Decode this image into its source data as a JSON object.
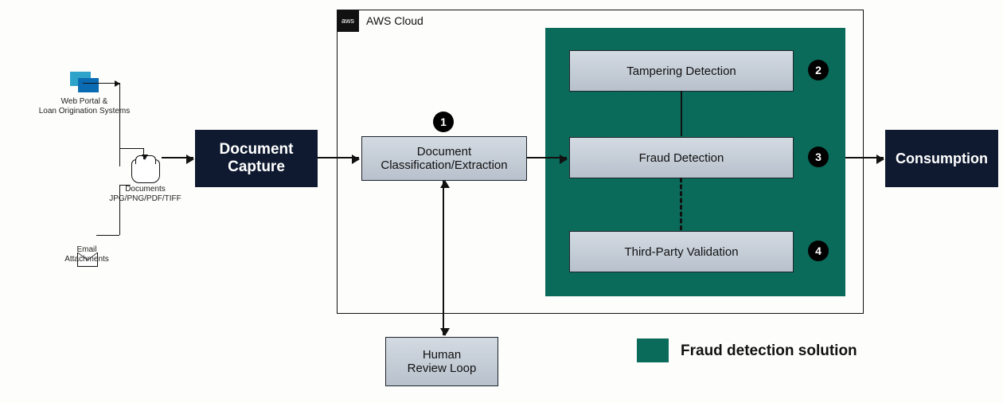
{
  "cloud": {
    "tab": "aws",
    "label": "AWS Cloud"
  },
  "sources": {
    "web": "Web Portal &\nLoan Origination Systems",
    "docs": "Documents\nJPG/PNG/PDF/TIFF",
    "email": "Email\nAttachments"
  },
  "boxes": {
    "capture": "Document\nCapture",
    "classify": "Document\nClassification/Extraction",
    "tamper": "Tampering Detection",
    "fraud": "Fraud Detection",
    "tpv": "Third-Party Validation",
    "consume": "Consumption",
    "human": "Human\nReview Loop"
  },
  "badges": {
    "b1": "1",
    "b2": "2",
    "b3": "3",
    "b4": "4"
  },
  "legend": {
    "label": "Fraud detection solution"
  }
}
